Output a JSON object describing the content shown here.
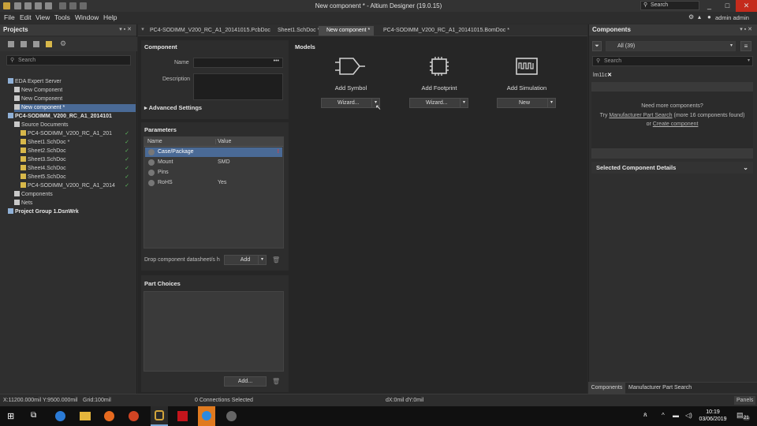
{
  "window": {
    "title": "New component * - Altium Designer (19.0.15)",
    "search": "Search",
    "user": "admin admin"
  },
  "menu": [
    "File",
    "Edit",
    "View",
    "Tools",
    "Window",
    "Help"
  ],
  "tabs": [
    {
      "label": "PC4-SODIMM_V200_RC_A1_20141015.PcbDoc",
      "active": false
    },
    {
      "label": "Sheet1.SchDoc *",
      "active": false
    },
    {
      "label": "New component *",
      "active": true
    },
    {
      "label": "PC4-SODIMM_V200_RC_A1_20141015.BomDoc *",
      "active": false
    }
  ],
  "projects": {
    "header": "Projects",
    "search_placeholder": "Search",
    "items": [
      {
        "label": "EDA Expert Server",
        "indent": 0
      },
      {
        "label": "New Component",
        "indent": 1
      },
      {
        "label": "New Component",
        "indent": 1
      },
      {
        "label": "New component *",
        "indent": 1,
        "selected": true
      },
      {
        "label": "PC4-SODIMM_V200_RC_A1_2014101",
        "indent": 0,
        "bold": true
      },
      {
        "label": "Source Documents",
        "indent": 1
      },
      {
        "label": "PC4-SODIMM_V200_RC_A1_201",
        "indent": 2
      },
      {
        "label": "Sheet1.SchDoc *",
        "indent": 2
      },
      {
        "label": "Sheet2.SchDoc",
        "indent": 2
      },
      {
        "label": "Sheet3.SchDoc",
        "indent": 2
      },
      {
        "label": "Sheet4.SchDoc",
        "indent": 2
      },
      {
        "label": "Sheet5.SchDoc",
        "indent": 2
      },
      {
        "label": "PC4-SODIMM_V200_RC_A1_2014",
        "indent": 2
      },
      {
        "label": "Components",
        "indent": 1
      },
      {
        "label": "Nets",
        "indent": 1
      },
      {
        "label": "Project Group 1.DsnWrk",
        "indent": 0,
        "bold": true
      }
    ]
  },
  "component": {
    "section": "Component",
    "name_label": "Name",
    "description_label": "Description",
    "advanced": "Advanced Settings"
  },
  "parameters": {
    "section": "Parameters",
    "col_name": "Name",
    "col_value": "Value",
    "rows": [
      {
        "name": "Case/Package",
        "value": ""
      },
      {
        "name": "Mount",
        "value": "SMD"
      },
      {
        "name": "Pins",
        "value": ""
      },
      {
        "name": "RoHS",
        "value": "Yes"
      }
    ],
    "drop_text": "Drop component datasheet/s h",
    "add": "Add"
  },
  "part_choices": {
    "section": "Part Choices",
    "add": "Add..."
  },
  "models": {
    "section": "Models",
    "items": [
      {
        "title": "Add Symbol",
        "button": "Wizard..."
      },
      {
        "title": "Add Footprint",
        "button": "Wizard..."
      },
      {
        "title": "Add Simulation",
        "button": "New"
      }
    ]
  },
  "components_panel": {
    "header": "Components",
    "filter": "All",
    "count": "(39)",
    "search_placeholder": "Search",
    "tag": "lm11c",
    "need_more": "Need more components?",
    "try": "Try",
    "mps_link": "Manufacturer Part Search",
    "more_text": "(more 16 components found)",
    "or": "or",
    "create_link": "Create component",
    "details": "Selected Component Details",
    "bottom_tabs": [
      "Components",
      "Manufacturer Part Search"
    ]
  },
  "status": {
    "coords": "X:11200.000mil Y:9500.000mil",
    "grid": "Grid:100mil",
    "connections": "0 Connections Selected",
    "delta": "dX:0mil dY:0mil",
    "panels": "Panels"
  },
  "taskbar": {
    "time": "10:19",
    "date": "03/06/2019",
    "notif": "21"
  }
}
